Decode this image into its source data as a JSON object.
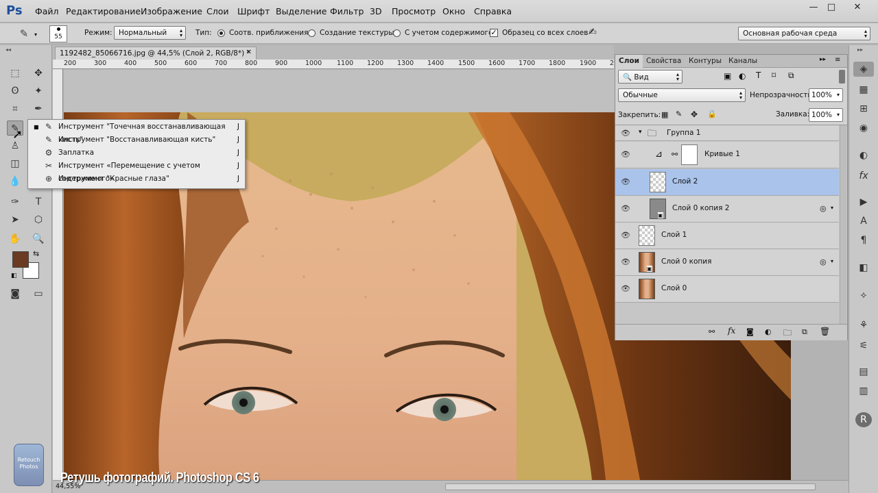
{
  "app": {
    "logo": "Ps"
  },
  "menu": [
    "Файл",
    "Редактирование",
    "Изображение",
    "Слои",
    "Шрифт",
    "Выделение",
    "Фильтр",
    "3D",
    "Просмотр",
    "Окно",
    "Справка"
  ],
  "window_controls": [
    "—",
    "□",
    "✕"
  ],
  "options": {
    "brush_size": "55",
    "mode_label": "Режим:",
    "mode_value": "Нормальный",
    "type_label": "Тип:",
    "type_options": [
      "Соотв. приближения",
      "Создание текстуры",
      "С учетом содержимого"
    ],
    "sample_all": "Образец со всех слоев",
    "workspace": "Основная рабочая среда"
  },
  "document": {
    "tab_title": "1192482_85066716.jpg @ 44,5% (Слой 2, RGB/8*) *",
    "ruler_h": [
      "200",
      "300",
      "400",
      "500",
      "600",
      "700",
      "800",
      "900",
      "1000",
      "1100",
      "1200",
      "1300",
      "1400",
      "1500",
      "1600",
      "1700",
      "1800",
      "1900",
      "2"
    ],
    "status_left": "44,55%"
  },
  "flyout": {
    "items": [
      {
        "label": "Инструмент \"Точечная восстанавливающая кисть\"",
        "key": "J",
        "icon": "spot-healing-brush-icon",
        "active": true
      },
      {
        "label": "Инструмент \"Восстанавливающая кисть\"",
        "key": "J",
        "icon": "healing-brush-icon",
        "active": false
      },
      {
        "label": "Заплатка",
        "key": "J",
        "icon": "patch-icon",
        "active": false
      },
      {
        "label": "Инструмент «Перемещение с учетом содержимого»",
        "key": "J",
        "icon": "content-aware-move-icon",
        "active": false
      },
      {
        "label": "Инструмент \"Красные глаза\"",
        "key": "J",
        "icon": "red-eye-icon",
        "active": false
      }
    ]
  },
  "layers_panel": {
    "tabs": [
      "Слои",
      "Свойства",
      "Контуры",
      "Каналы"
    ],
    "filter_label": "Вид",
    "blend_mode": "Обычные",
    "opacity_label": "Непрозрачность:",
    "opacity_value": "100%",
    "lock_label": "Закрепить:",
    "fill_label": "Заливка:",
    "fill_value": "100%",
    "layers": [
      {
        "name": "Группа 1",
        "type": "group"
      },
      {
        "name": "Кривые 1",
        "type": "adjustment"
      },
      {
        "name": "Слой 2",
        "type": "layer",
        "selected": true
      },
      {
        "name": "Слой 0 копия 2",
        "type": "smart"
      },
      {
        "name": "Слой 1",
        "type": "layer"
      },
      {
        "name": "Слой 0 копия",
        "type": "smart-photo"
      },
      {
        "name": "Слой 0",
        "type": "photo"
      }
    ]
  },
  "caption": "Ретушь фотографий. Photoshop CS 6",
  "badge_text": "Retouch Photos",
  "colors": {
    "foreground": "#6b3a22",
    "background": "#ffffff",
    "selection": "#aac3ea"
  }
}
